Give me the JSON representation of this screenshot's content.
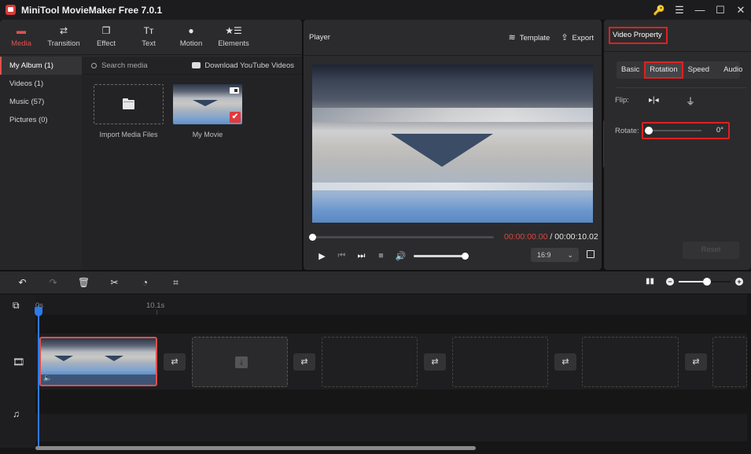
{
  "app": {
    "title": "MiniTool MovieMaker Free 7.0.1"
  },
  "window_controls": [
    {
      "name": "key-icon",
      "glyph": "🔑"
    },
    {
      "name": "menu-icon",
      "glyph": "☰"
    },
    {
      "name": "minimize-icon",
      "glyph": "—"
    },
    {
      "name": "maximize-icon",
      "glyph": "☐"
    },
    {
      "name": "close-icon",
      "glyph": "✕"
    }
  ],
  "toolbar": {
    "items": [
      {
        "label": "Media",
        "icon": "folder-icon",
        "glyph": "▬",
        "active": true
      },
      {
        "label": "Transition",
        "icon": "transition-icon",
        "glyph": "⇄"
      },
      {
        "label": "Effect",
        "icon": "effect-icon",
        "glyph": "❐"
      },
      {
        "label": "Text",
        "icon": "text-icon",
        "glyph": "Tт"
      },
      {
        "label": "Motion",
        "icon": "motion-icon",
        "glyph": "●"
      },
      {
        "label": "Elements",
        "icon": "elements-icon",
        "glyph": "★☰"
      }
    ]
  },
  "sidebar": {
    "items": [
      {
        "label": "My Album (1)",
        "active": true
      },
      {
        "label": "Videos (1)"
      },
      {
        "label": "Music (57)"
      },
      {
        "label": "Pictures (0)"
      }
    ]
  },
  "media": {
    "search_placeholder": "Search media",
    "download_label": "Download YouTube Videos",
    "import_label": "Import Media Files",
    "items": [
      {
        "label": "My Movie",
        "selected": true
      }
    ]
  },
  "player": {
    "title": "Player",
    "template_label": "Template",
    "export_label": "Export",
    "current_time": "00:00:00.00",
    "separator": " / ",
    "total_time": "00:00:10.02",
    "progress": 0,
    "volume": 1.0,
    "aspect_ratio": "16:9",
    "controls": {
      "play": "▶",
      "prev": "⏮",
      "next": "⏭",
      "stop": "■",
      "volume": "🔊",
      "chevron": "⌄"
    }
  },
  "property": {
    "title": "Video Property",
    "tabs": [
      {
        "label": "Basic"
      },
      {
        "label": "Rotation",
        "active": true
      },
      {
        "label": "Speed"
      },
      {
        "label": "Audio"
      }
    ],
    "flip_label": "Flip:",
    "flip_h_glyph": "▸|◂",
    "flip_v_glyph": "⏚",
    "rotate_label": "Rotate:",
    "rotate_value": "0°",
    "rotate_fraction": 0,
    "reset_label": "Reset"
  },
  "timeline": {
    "tools": [
      {
        "name": "undo-icon",
        "glyph": "↶"
      },
      {
        "name": "redo-icon",
        "glyph": "↷",
        "disabled": true
      },
      {
        "name": "delete-icon",
        "glyph": "🗑"
      },
      {
        "name": "split-icon",
        "glyph": "✂"
      },
      {
        "name": "speed-icon",
        "glyph": "◔"
      },
      {
        "name": "crop-icon",
        "glyph": "⌗"
      }
    ],
    "zoom_fraction": 0.55,
    "zoom_out_glyph": "−",
    "zoom_in_glyph": "+",
    "ruler": [
      "0s",
      "10.1s"
    ],
    "transition_glyph": "⇄",
    "add_track_glyph": "⧉",
    "video_track_glyph": "🎞",
    "music_track_glyph": "♫",
    "clip_audio_glyph": "🔈",
    "slot_download_glyph": "⤓"
  }
}
